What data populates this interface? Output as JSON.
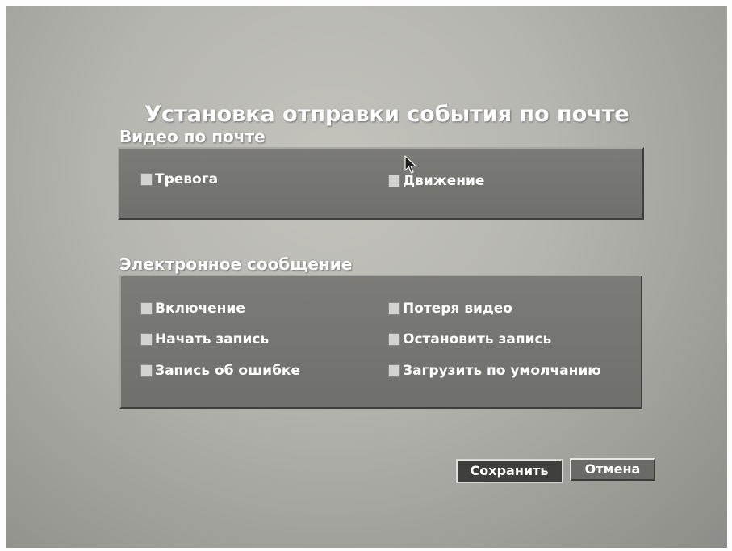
{
  "dialog": {
    "title": "Установка отправки события по почте"
  },
  "video_mail": {
    "label": "Видео по почте",
    "options": [
      {
        "label": "Тревога",
        "checked": false
      },
      {
        "label": "Движение",
        "checked": false
      }
    ]
  },
  "email_message": {
    "label": "Электронное сообщение",
    "options": [
      {
        "label": "Включение",
        "checked": false
      },
      {
        "label": "Потеря видео",
        "checked": false
      },
      {
        "label": "Начать запись",
        "checked": false
      },
      {
        "label": "Остановить запись",
        "checked": false
      },
      {
        "label": "Запись об ошибке",
        "checked": false
      },
      {
        "label": "Загрузить по умолчанию",
        "checked": false
      }
    ]
  },
  "buttons": {
    "save": "Сохранить",
    "cancel": "Отмена"
  },
  "colors": {
    "screen_background": "#b6b6b0",
    "panel": "#757572",
    "text": "#ffffff",
    "checkbox": "#d3d3d0",
    "save_button": "#3f3f3d"
  },
  "icons": [
    "mouse-pointer-icon"
  ]
}
